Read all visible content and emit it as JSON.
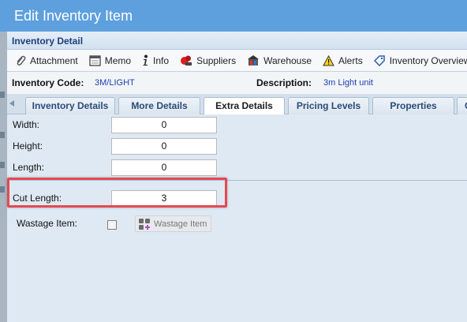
{
  "window": {
    "title": "Edit Inventory Item"
  },
  "panel": {
    "title": "Inventory Detail"
  },
  "toolbar": {
    "items": [
      {
        "label": "Attachment",
        "icon": "paperclip-icon"
      },
      {
        "label": "Memo",
        "icon": "memo-icon"
      },
      {
        "label": "Info",
        "icon": "info-icon"
      },
      {
        "label": "Suppliers",
        "icon": "suppliers-icon"
      },
      {
        "label": "Warehouse",
        "icon": "warehouse-icon"
      },
      {
        "label": "Alerts",
        "icon": "alert-icon"
      },
      {
        "label": "Inventory Overview",
        "icon": "tag-icon"
      }
    ]
  },
  "inventory": {
    "code_label": "Inventory Code:",
    "code_value": "3M/LIGHT",
    "description_label": "Description:",
    "description_value": "3m Light unit"
  },
  "tabs": [
    {
      "label": "Inventory Details",
      "active": false
    },
    {
      "label": "More Details",
      "active": false
    },
    {
      "label": "Extra Details",
      "active": true
    },
    {
      "label": "Pricing Levels",
      "active": false
    },
    {
      "label": "Properties",
      "active": false
    },
    {
      "label": "C",
      "active": false
    }
  ],
  "form": {
    "width": {
      "label": "Width:",
      "value": "0"
    },
    "height": {
      "label": "Height:",
      "value": "0"
    },
    "length": {
      "label": "Length:",
      "value": "0"
    },
    "cut_length": {
      "label": "Cut Length:",
      "value": "3"
    },
    "wastage": {
      "label": "Wastage Item:",
      "checked": false,
      "button_label": "Wastage Item"
    }
  },
  "colors": {
    "titlebar": "#5ea0de",
    "highlight": "#e34a52",
    "value_link": "#1e3fb0"
  }
}
